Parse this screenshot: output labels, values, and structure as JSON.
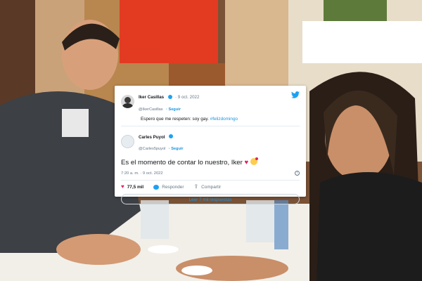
{
  "quoted_tweet": {
    "author_name": "Iker Casillas",
    "date": "· 9 oct. 2022",
    "handle": "@IkerCasillas",
    "follow_label": "· Seguir",
    "text": "Espero que me respeten: soy gay.",
    "hashtag": "#felizdomingo"
  },
  "tweet": {
    "author_name": "Carles Puyol",
    "handle": "@Carles5puyol",
    "follow_label": "· Seguir",
    "text": "Es el momento de contar lo nuestro, Iker",
    "heart_emoji": "♥",
    "timestamp": "7:20 a. m. · 9 oct. 2022",
    "info_icon": "i",
    "likes": "77,5 mil",
    "reply_label": "Responder",
    "share_label": "Compartir",
    "read_replies_label": "Leer 7 mil respuestas"
  },
  "icons": {
    "twitter": "twitter-bird-icon",
    "like": "heart-icon",
    "reply": "reply-bubble-icon",
    "share": "share-icon"
  },
  "colors": {
    "twitter_blue": "#1da1f2",
    "link_blue": "#1b95e0",
    "like_red": "#e0245e"
  }
}
